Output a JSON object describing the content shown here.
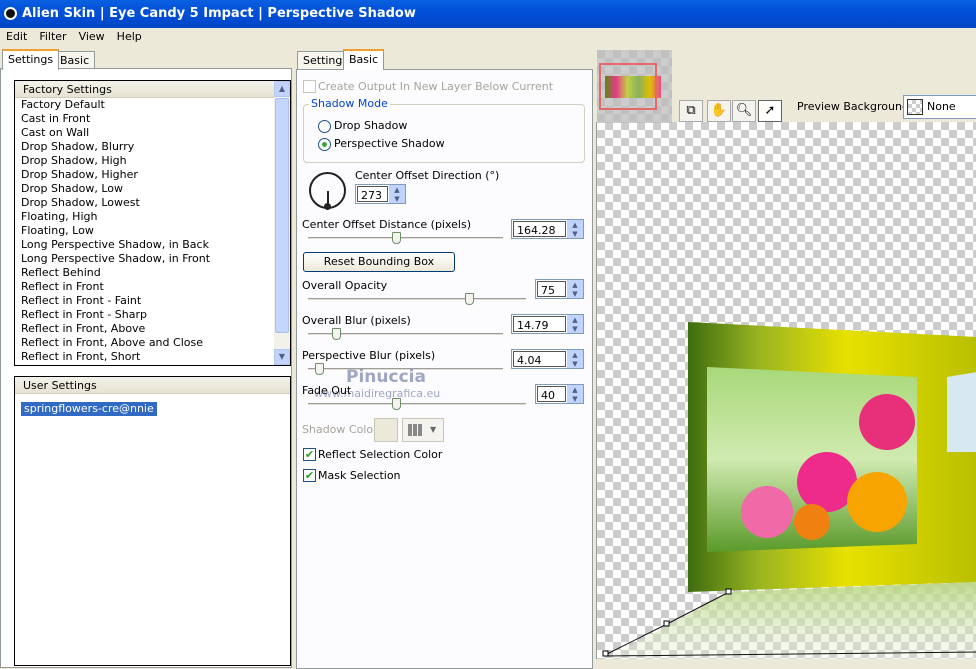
{
  "window": {
    "title": "Alien Skin | Eye Candy 5 Impact | Perspective Shadow"
  },
  "menu": [
    "Edit",
    "Filter",
    "View",
    "Help"
  ],
  "left_tabs": [
    "Settings",
    "Basic"
  ],
  "factory": {
    "header": "Factory Settings",
    "items": [
      "Factory Default",
      "Cast in Front",
      "Cast on Wall",
      "Drop Shadow, Blurry",
      "Drop Shadow, High",
      "Drop Shadow, Higher",
      "Drop Shadow, Low",
      "Drop Shadow, Lowest",
      "Floating, High",
      "Floating, Low",
      "Long Perspective Shadow, in Back",
      "Long Perspective Shadow, in Front",
      "Reflect Behind",
      "Reflect in Front",
      "Reflect in Front - Faint",
      "Reflect in Front - Sharp",
      "Reflect in Front, Above",
      "Reflect in Front, Above and Close",
      "Reflect in Front, Short"
    ]
  },
  "user": {
    "header": "User Settings",
    "items": [
      "springflowers-cre@nnie"
    ],
    "selected": 0
  },
  "mid_tabs": [
    "Settings",
    "Basic"
  ],
  "basic": {
    "create_output": "Create Output In New Layer Below Current",
    "create_output_checked": false,
    "shadow_mode": {
      "label": "Shadow Mode",
      "options": [
        "Drop Shadow",
        "Perspective Shadow"
      ],
      "selected": 1
    },
    "direction": {
      "label": "Center Offset Direction (°)",
      "value": "273"
    },
    "distance": {
      "label": "Center Offset Distance (pixels)",
      "value": "164.28",
      "slider": 0.45
    },
    "reset": "Reset Bounding Box",
    "opacity": {
      "label": "Overall Opacity",
      "value": "75",
      "slider": 0.75
    },
    "blur": {
      "label": "Overall Blur (pixels)",
      "value": "14.79",
      "slider": 0.13
    },
    "pblur": {
      "label": "Perspective Blur (pixels)",
      "value": "4.04",
      "slider": 0.04
    },
    "fade": {
      "label": "Fade Out",
      "value": "40",
      "slider": 0.4
    },
    "shadow_color": {
      "label": "Shadow Color",
      "color": "#ece9d8"
    },
    "reflect": {
      "label": "Reflect Selection Color",
      "checked": true
    },
    "mask": {
      "label": "Mask Selection",
      "checked": true
    }
  },
  "watermark": {
    "name": "Pinuccia",
    "url": "www.maidiregrafica.eu"
  },
  "preview": {
    "background_label": "Preview Background:",
    "background_value": "None"
  }
}
